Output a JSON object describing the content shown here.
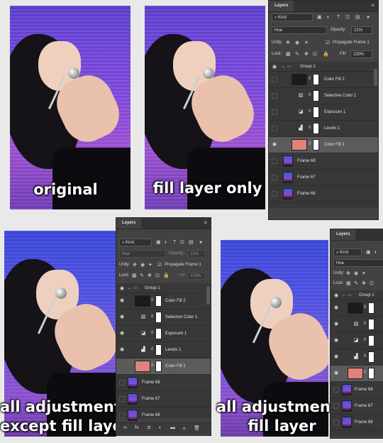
{
  "captions": {
    "original": "original",
    "fill_only": "fill layer only",
    "all_except_line1": "all adjustments",
    "all_except_line2": "except fill layer",
    "all_plus_line1": "all adjustments +",
    "all_plus_line2": "fill layer"
  },
  "panel": {
    "tab": "Layers",
    "menu_glyph": "≡",
    "kind_label": "Kind",
    "blend_mode": "Hue",
    "opacity_label": "Opacity:",
    "opacity_value": "21%",
    "unify_label": "Unify:",
    "propagate_label": "Propagate Frame 1",
    "lock_label": "Lock:",
    "fill_label": "Fill:",
    "fill_value": "100%",
    "group_name": "Group 1",
    "layers": [
      {
        "name": "Color Fill 2",
        "type": "fill",
        "thumb_color": "#1b1b1b"
      },
      {
        "name": "Selective Color 1",
        "type": "adjust",
        "icon": "▧"
      },
      {
        "name": "Exposure 1",
        "type": "adjust",
        "icon": "◪"
      },
      {
        "name": "Levels 1",
        "type": "adjust",
        "icon": "▟"
      },
      {
        "name": "Color Fill 1",
        "type": "fill",
        "thumb_color": "#e0837a"
      }
    ],
    "frames": [
      "Frame 68",
      "Frame 67",
      "Frame 66"
    ],
    "footer_icons": [
      "∞",
      "fx",
      "◘",
      "◐",
      "▬",
      "＋",
      "🗑"
    ]
  },
  "colors": {
    "panel_bg": "#424242",
    "selected_row": "#5b5b5b",
    "fill_swatch": "#e0837a"
  }
}
